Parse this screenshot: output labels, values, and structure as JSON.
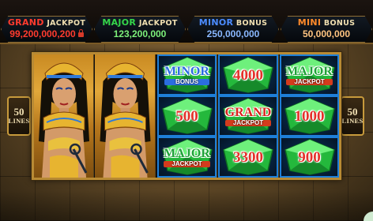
{
  "jackpots": {
    "grand": {
      "word": "GRAND",
      "sub": "JACKPOT",
      "value": "99,200,000,200"
    },
    "major": {
      "word": "MAJOR",
      "sub": "JACKPOT",
      "value": "123,200,000"
    },
    "minor": {
      "word": "MINOR",
      "sub": "BONUS",
      "value": "250,000,000"
    },
    "mini": {
      "word": "MINI",
      "sub": "BONUS",
      "value": "50,000,000"
    }
  },
  "lines": {
    "count": "50",
    "label": "LINES"
  },
  "reels": {
    "cleopatra_symbol": "cleopatra-symbol",
    "reel3": [
      {
        "type": "word",
        "main": "MINOR",
        "sub": "BONUS"
      },
      {
        "type": "number",
        "main": "500"
      },
      {
        "type": "word",
        "main": "MAJOR",
        "sub": "JACKPOT"
      }
    ],
    "reel4": [
      {
        "type": "number",
        "main": "4000"
      },
      {
        "type": "word",
        "main": "GRAND",
        "sub": "JACKPOT"
      },
      {
        "type": "number",
        "main": "3300"
      }
    ],
    "reel5": [
      {
        "type": "word",
        "main": "MAJOR",
        "sub": "JACKPOT"
      },
      {
        "type": "number",
        "main": "1000"
      },
      {
        "type": "number",
        "main": "900"
      }
    ]
  },
  "colors": {
    "gem_green": "#2fd44a",
    "cell_border": "#1e7fd8",
    "grand_red": "#ff3b2e",
    "major_green": "#35d64a",
    "minor_blue": "#4c8cff",
    "mini_orange": "#ff8a2a",
    "frame_gold": "#b88a34"
  }
}
